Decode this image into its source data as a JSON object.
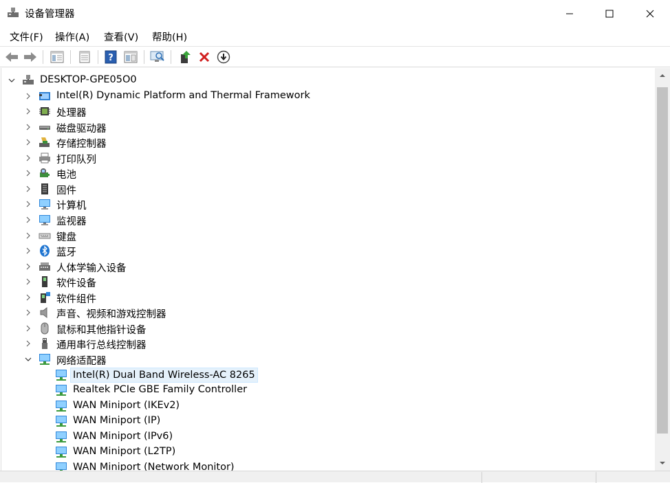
{
  "window": {
    "title": "设备管理器"
  },
  "menu": [
    "文件(F)",
    "操作(A)",
    "查看(V)",
    "帮助(H)"
  ],
  "toolbar": {
    "buttons": [
      "back-icon",
      "forward-icon",
      "show-hide-tree-icon",
      "properties-icon",
      "help-icon",
      "update-driver-view-icon",
      "scan-hardware-icon",
      "update-driver-icon",
      "uninstall-icon",
      "disable-download-icon"
    ]
  },
  "tree": {
    "root": "DESKTOP-GPE05O0",
    "categories": [
      {
        "label": "Intel(R) Dynamic Platform and Thermal Framework",
        "icon": "thermal-framework-icon"
      },
      {
        "label": "处理器",
        "icon": "processor-icon"
      },
      {
        "label": "磁盘驱动器",
        "icon": "disk-drive-icon"
      },
      {
        "label": "存储控制器",
        "icon": "storage-controller-icon"
      },
      {
        "label": "打印队列",
        "icon": "printer-icon"
      },
      {
        "label": "电池",
        "icon": "battery-icon"
      },
      {
        "label": "固件",
        "icon": "firmware-icon"
      },
      {
        "label": "计算机",
        "icon": "computer-icon"
      },
      {
        "label": "监视器",
        "icon": "monitor-icon"
      },
      {
        "label": "键盘",
        "icon": "keyboard-icon"
      },
      {
        "label": "蓝牙",
        "icon": "bluetooth-icon"
      },
      {
        "label": "人体学输入设备",
        "icon": "hid-icon"
      },
      {
        "label": "软件设备",
        "icon": "software-device-icon"
      },
      {
        "label": "软件组件",
        "icon": "software-component-icon"
      },
      {
        "label": "声音、视频和游戏控制器",
        "icon": "speaker-icon"
      },
      {
        "label": "鼠标和其他指针设备",
        "icon": "mouse-icon"
      },
      {
        "label": "通用串行总线控制器",
        "icon": "usb-icon"
      },
      {
        "label": "网络适配器",
        "icon": "network-adapter-icon"
      }
    ],
    "network_children": [
      "Intel(R) Dual Band Wireless-AC 8265",
      "Realtek PCIe GBE Family Controller",
      "WAN Miniport (IKEv2)",
      "WAN Miniport (IP)",
      "WAN Miniport (IPv6)",
      "WAN Miniport (L2TP)",
      "WAN Miniport (Network Monitor)"
    ]
  },
  "colors": {
    "selection": "#e5f1fb",
    "accent": "#0078d7"
  }
}
